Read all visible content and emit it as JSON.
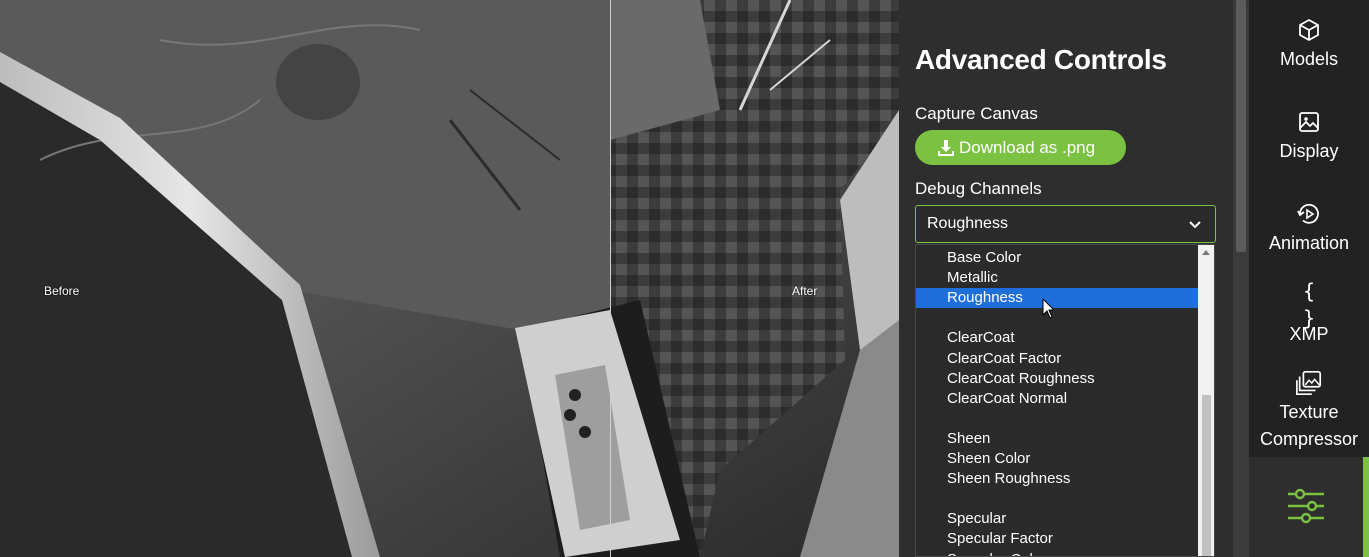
{
  "viewport": {
    "before_label": "Before",
    "after_label": "After"
  },
  "panel": {
    "title": "Advanced Controls",
    "capture": {
      "label": "Capture Canvas",
      "download_button": "Download as .png",
      "download_icon": "download-icon"
    },
    "debug": {
      "label": "Debug Channels",
      "selected": "Roughness",
      "options": [
        "Base Color",
        "Metallic",
        "Roughness",
        "",
        "ClearCoat",
        "ClearCoat Factor",
        "ClearCoat Roughness",
        "ClearCoat Normal",
        "",
        "Sheen",
        "Sheen Color",
        "Sheen Roughness",
        "",
        "Specular",
        "Specular Factor",
        "Specular Color"
      ]
    }
  },
  "nav": {
    "items": [
      {
        "label": "Models",
        "icon": "cube-icon"
      },
      {
        "label": "Display",
        "icon": "image-icon"
      },
      {
        "label": "Animation",
        "icon": "play-rotate-icon"
      },
      {
        "label": "XMP",
        "icon": "braces-icon"
      },
      {
        "label": "Texture Compressor",
        "icon": "images-icon"
      },
      {
        "label": "",
        "icon": "sliders-icon"
      }
    ]
  },
  "colors": {
    "accent": "#7cc242",
    "selection": "#1e6fd9",
    "panel_bg": "#2e2e2e",
    "nav_bg": "#222222"
  }
}
